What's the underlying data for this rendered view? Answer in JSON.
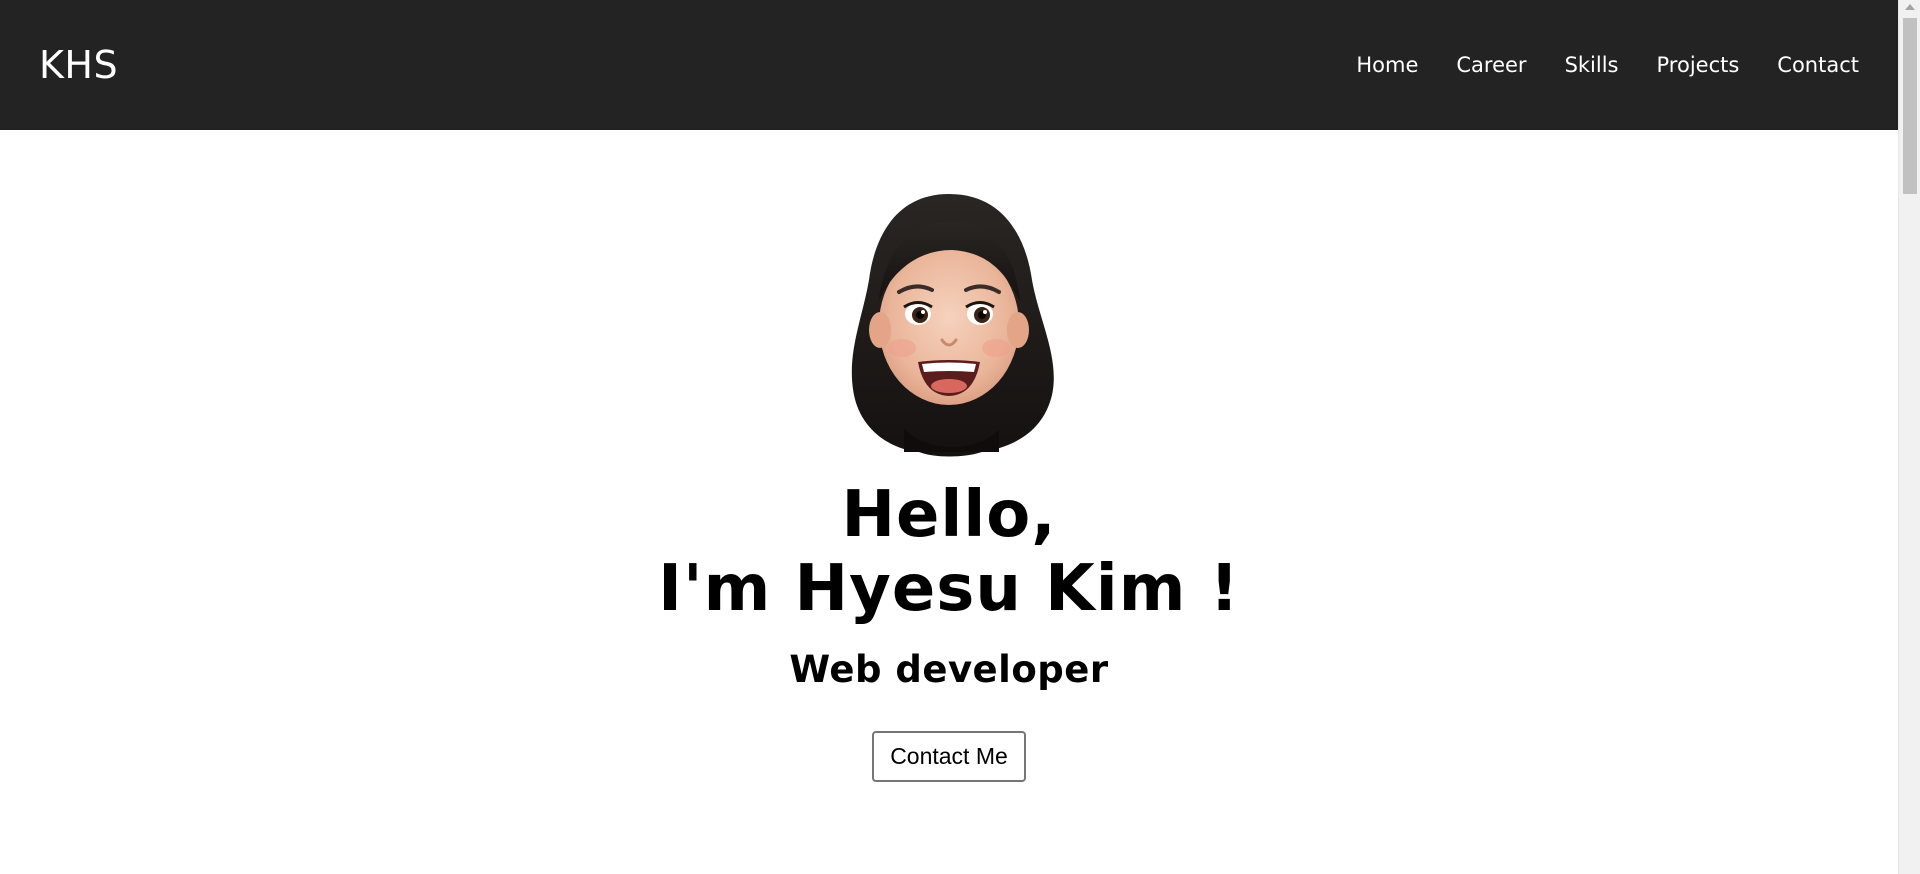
{
  "nav": {
    "logo": "KHS",
    "items": [
      {
        "label": "Home"
      },
      {
        "label": "Career"
      },
      {
        "label": "Skills"
      },
      {
        "label": "Projects"
      },
      {
        "label": "Contact"
      }
    ]
  },
  "hero": {
    "avatar_icon": "memoji-avatar",
    "title_line1": "Hello,",
    "title_line2": "I'm Hyesu Kim !",
    "subtitle": "Web developer",
    "button_label": "Contact Me"
  },
  "colors": {
    "navbar_bg": "#232323",
    "nav_text": "#ffffff",
    "page_bg": "#ffffff",
    "text": "#000000"
  }
}
